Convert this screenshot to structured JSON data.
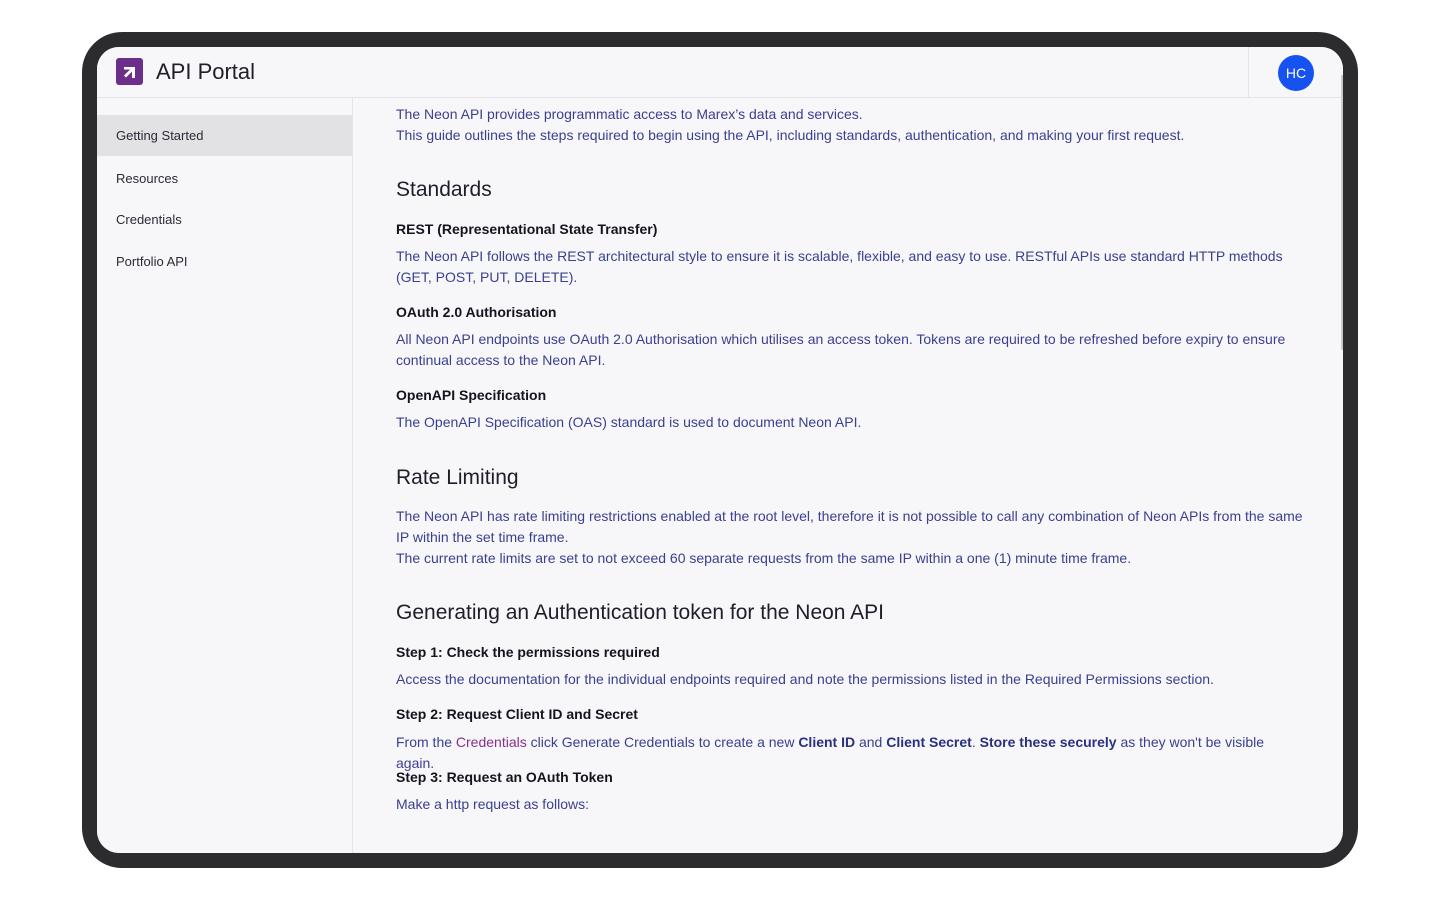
{
  "app": {
    "title": "API Portal",
    "avatar_initials": "HC",
    "brand_color": "#6b2e8a",
    "avatar_color": "#1652f0"
  },
  "sidebar": {
    "items": [
      {
        "label": "Getting Started",
        "active": true
      },
      {
        "label": "Resources",
        "active": false
      },
      {
        "label": "Credentials",
        "active": false
      },
      {
        "label": "Portfolio API",
        "active": false
      }
    ]
  },
  "content": {
    "intro_1": "The Neon API provides programmatic access to Marex’s data and services.",
    "intro_2": "This guide outlines the steps required to begin using the API, including standards, authentication, and making your first request.",
    "standards": {
      "heading": "Standards",
      "rest_title": "REST (Representational State Transfer)",
      "rest_body": "The Neon API follows the REST architectural style to ensure it is scalable, flexible, and easy to use. RESTful APIs use standard HTTP methods (GET, POST, PUT, DELETE).",
      "oauth_title": "OAuth 2.0 Authorisation",
      "oauth_body": "All Neon API endpoints use OAuth 2.0 Authorisation which utilises an access token. Tokens are required to be refreshed before expiry to ensure continual access to the Neon API.",
      "openapi_title": "OpenAPI Specification",
      "openapi_body": "The OpenAPI Specification (OAS) standard is used to document Neon API."
    },
    "rate_limiting": {
      "heading": "Rate Limiting",
      "body_1": "The Neon API has rate limiting restrictions enabled at the root level, therefore it is not possible to call any combination of Neon APIs from the same IP within the set time frame.",
      "body_2": "The current rate limits are set to not exceed 60 separate requests from the same IP within a one (1) minute time frame."
    },
    "auth_token": {
      "heading": "Generating an Authentication token for the Neon API",
      "step1_title": "Step 1: Check the permissions required",
      "step1_body": "Access the documentation for the individual endpoints required and note the permissions listed in the Required Permissions section.",
      "step2_title": "Step 2: Request Client ID and Secret",
      "step2_pre": "From the ",
      "step2_link": "Credentials",
      "step2_mid1": " click Generate Credentials to create a new ",
      "step2_client_id": "Client ID",
      "step2_and": " and ",
      "step2_client_secret": "Client Secret",
      "step2_dot": ". ",
      "step2_store": "Store these securely",
      "step2_post": " as they won't be visible again.",
      "step3_title": "Step 3: Request an OAuth Token",
      "step3_body": "Make a http request as follows:"
    }
  }
}
